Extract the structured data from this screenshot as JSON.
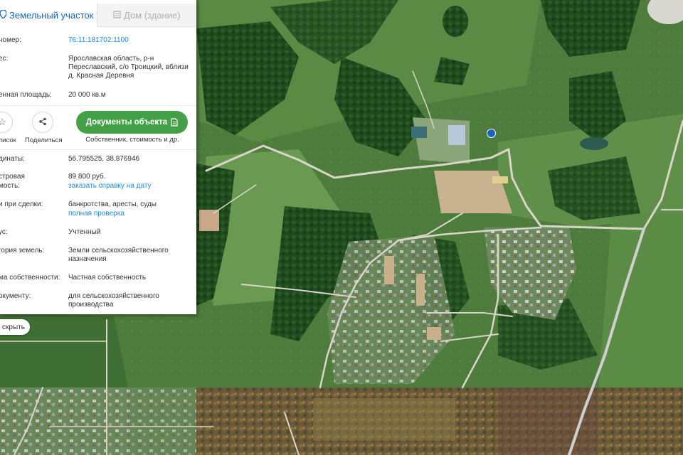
{
  "tabs": [
    {
      "label": "Земельный участок",
      "icon": "map-pin-icon",
      "active": true
    },
    {
      "label": "Дом (здание)",
      "icon": "building-icon",
      "active": false
    }
  ],
  "rows": {
    "cadastral": {
      "label": "номер:",
      "value": "76:11:181702:1100"
    },
    "address": {
      "label": "ес:",
      "value": "Ярославская область, р-н Переславский, с/о Троицкий, вблизи д. Красная Деревня"
    },
    "area": {
      "label": "енная площадь:",
      "value": "20 000 кв.м"
    },
    "coords": {
      "label": "динаты:",
      "value": "56.795525, 38.876946"
    },
    "cost": {
      "label1": "стровая",
      "label2": "мость:",
      "value": "89 800 руб.",
      "link": "заказать справку на дату"
    },
    "risks": {
      "label": "и при сделки:",
      "value": "банкротства, аресты, суды",
      "link": "полная проверка"
    },
    "status": {
      "label": "ус:",
      "value": "Учтенный"
    },
    "category": {
      "label": "гория земель:",
      "value": "Земли сельскохозяйственного назначения"
    },
    "ownership": {
      "label": "ма собственности:",
      "value": "Частная собственность"
    },
    "usage": {
      "label": "окументу:",
      "value": "для сельскохозяйственного производства"
    }
  },
  "actions": {
    "list_label": "писок",
    "share_label": "Поделиться",
    "docs_button": "Документы объекта",
    "docs_sub": "Собственник, стоимость и др."
  },
  "hide_button": "скрыть",
  "colors": {
    "accent": "#1565c0",
    "link": "#1e88e5",
    "button": "#43a047",
    "marker": "#1565c0"
  }
}
